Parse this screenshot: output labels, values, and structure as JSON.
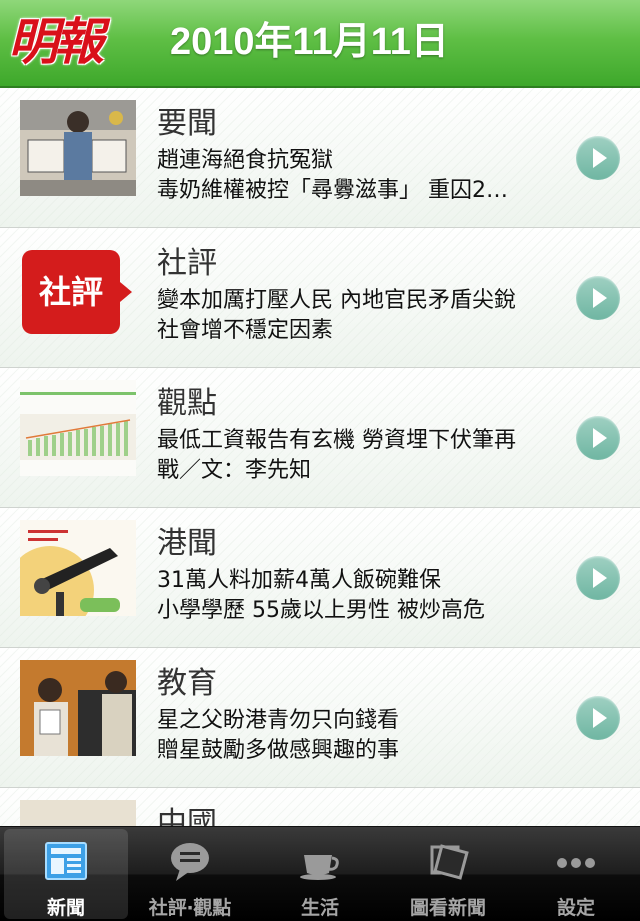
{
  "header": {
    "logo": "明報",
    "date": "2010年11月11日"
  },
  "rows": [
    {
      "title": "要聞",
      "line1": "趙連海絕食抗冤獄",
      "line2": "毒奶維權被控「尋釁滋事」 重囚2…"
    },
    {
      "title": "社評",
      "line1": "變本加厲打壓人民 內地官民矛盾尖銳",
      "line2": "社會增不穩定因素",
      "thumb_text": "社評"
    },
    {
      "title": "觀點",
      "line1": "最低工資報告有玄機 勞資埋下伏筆再",
      "line2": "戰／文：李先知"
    },
    {
      "title": "港聞",
      "line1": "31萬人料加薪4萬人飯碗難保",
      "line2": "小學學歷 55歲以上男性 被炒高危"
    },
    {
      "title": "教育",
      "line1": "星之父盼港青勿只向錢看",
      "line2": "贈星鼓勵多做感興趣的事"
    },
    {
      "title": "中國",
      "line1": "",
      "line2": ""
    }
  ],
  "tabs": [
    {
      "label": "新聞",
      "icon": "newspaper-icon"
    },
    {
      "label": "社評‧觀點",
      "icon": "speech-bubble-icon"
    },
    {
      "label": "生活",
      "icon": "coffee-cup-icon"
    },
    {
      "label": "圖看新聞",
      "icon": "photo-frame-icon"
    },
    {
      "label": "設定",
      "icon": "more-dots-icon"
    }
  ],
  "colors": {
    "header_green": "#5fbf45",
    "logo_red": "#d9101a",
    "arrow_teal": "#6fb6a2",
    "tabbar": "#1d1d1d"
  }
}
